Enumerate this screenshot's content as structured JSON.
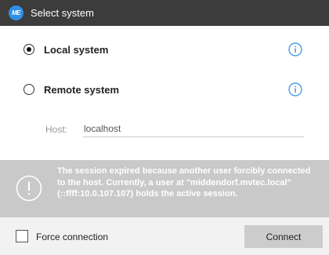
{
  "window": {
    "title": "Select system",
    "logo_text": "ME"
  },
  "options": {
    "local": {
      "label": "Local system",
      "selected": true,
      "icon": "info-icon"
    },
    "remote": {
      "label": "Remote system",
      "selected": false,
      "icon": "info-icon"
    }
  },
  "host": {
    "label": "Host:",
    "value": "localhost"
  },
  "alert": {
    "icon": "warning-circle-icon",
    "message": "The session expired because another user forcibly connected to the host. Currently, a user at \"middendorf.mvtec.local\" (::ffff:10.0.107.107) holds the active session."
  },
  "footer": {
    "force_label": "Force connection",
    "force_checked": false,
    "connect_label": "Connect"
  },
  "colors": {
    "accent": "#2f8fe6",
    "titlebar": "#3c3c3c",
    "alert_bg": "#c9c9c9"
  }
}
